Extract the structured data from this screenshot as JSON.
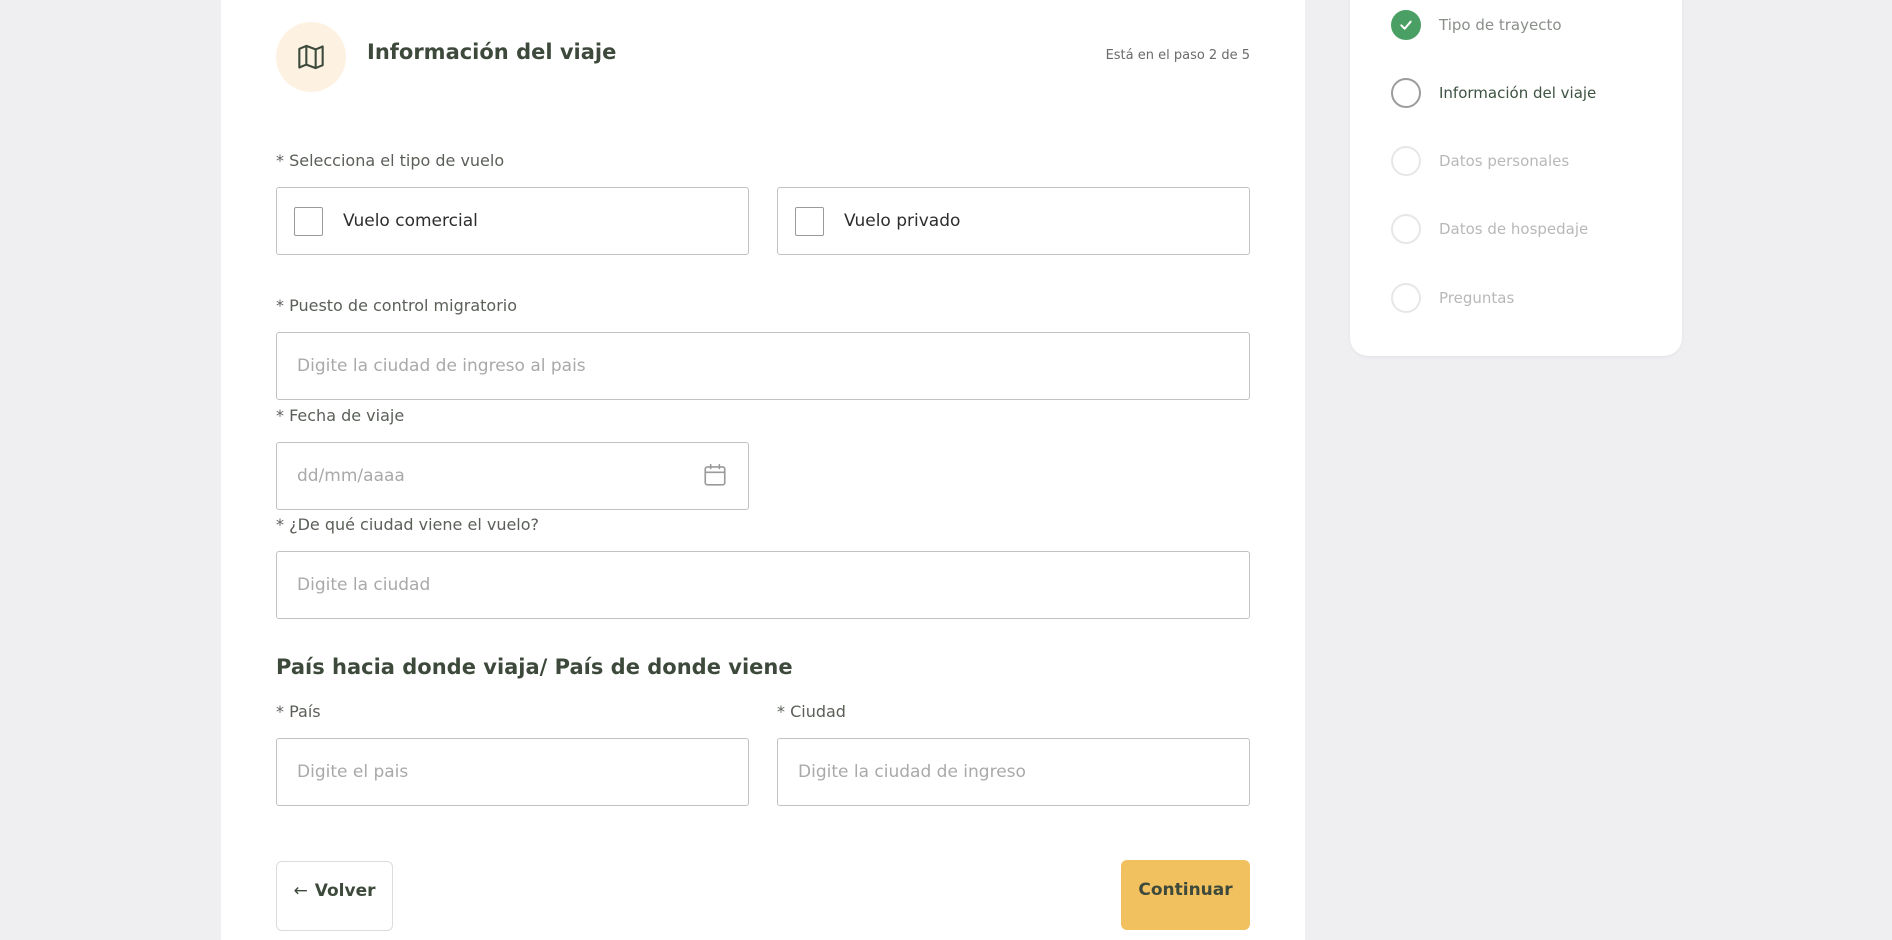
{
  "header": {
    "icon": "map-icon",
    "title": "Información del viaje",
    "step_indicator": "Está en el paso 2 de 5"
  },
  "flight_type": {
    "label": "* Selecciona el tipo de vuelo",
    "options": [
      {
        "label": "Vuelo comercial",
        "checked": false
      },
      {
        "label": "Vuelo privado",
        "checked": false
      }
    ]
  },
  "migration_checkpoint": {
    "label": "* Puesto de control migratorio",
    "placeholder": "Digite la ciudad de ingreso al pais",
    "value": ""
  },
  "travel_date": {
    "label": "* Fecha de viaje",
    "placeholder": "dd/mm/aaaa",
    "value": "",
    "icon": "calendar-icon"
  },
  "origin_city": {
    "label": "* ¿De qué ciudad viene el vuelo?",
    "placeholder": "Digite la ciudad",
    "value": ""
  },
  "destination_section": {
    "title": "País hacia donde viaja/ País de donde viene",
    "country": {
      "label": "* País",
      "placeholder": "Digite el pais",
      "value": ""
    },
    "city": {
      "label": "* Ciudad",
      "placeholder": "Digite la ciudad de ingreso",
      "value": ""
    }
  },
  "actions": {
    "back_label": "Volver",
    "back_icon": "arrow-left-icon",
    "continue_label": "Continuar"
  },
  "steps": [
    {
      "label": "Tipo de trayecto",
      "status": "done"
    },
    {
      "label": "Información del viaje",
      "status": "current"
    },
    {
      "label": "Datos personales",
      "status": "pending"
    },
    {
      "label": "Datos de hospedaje",
      "status": "pending"
    },
    {
      "label": "Preguntas",
      "status": "pending"
    }
  ],
  "colors": {
    "accent_button": "#f2c15f",
    "step_done": "#4aa064",
    "icon_circle": "#fdf1e2",
    "heading": "#3d4a3b"
  }
}
